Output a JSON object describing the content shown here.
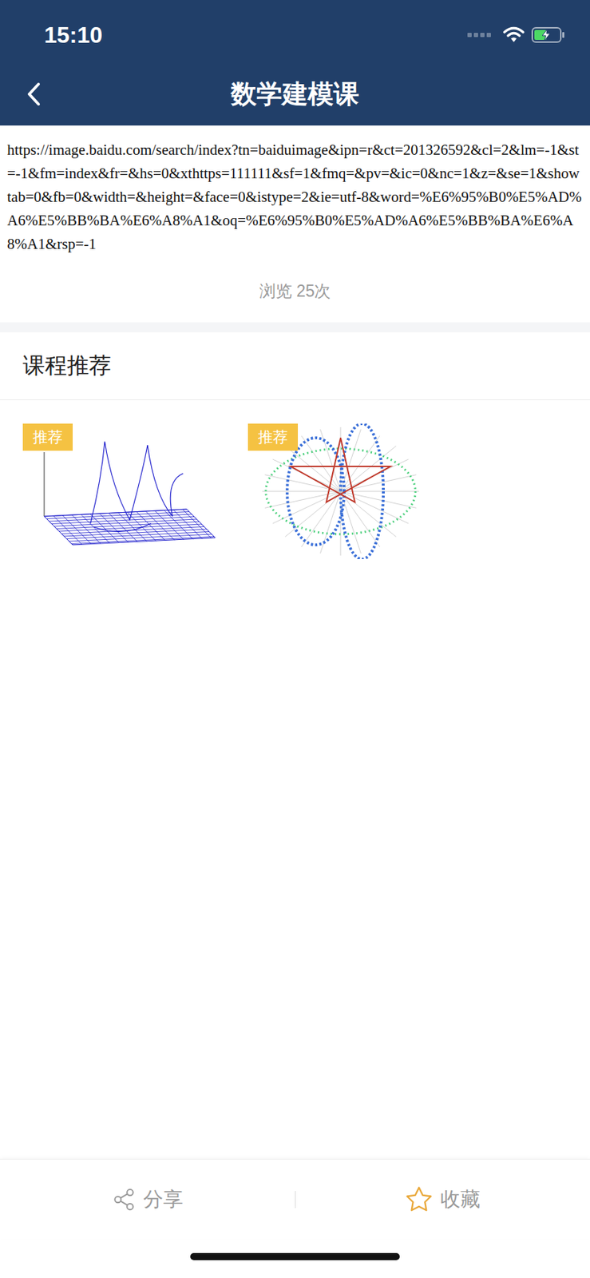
{
  "status_bar": {
    "time": "15:10",
    "battery": {
      "level": 0.5,
      "charging": true
    }
  },
  "nav": {
    "title": "数学建模课"
  },
  "article": {
    "url": "https://image.baidu.com/search/index?tn=baiduimage&ipn=r&ct=201326592&cl=2&lm=-1&st=-1&fm=index&fr=&hs=0&xthttps=111111&sf=1&fmq=&pv=&ic=0&nc=1&z=&se=1&showtab=0&fb=0&width=&height=&face=0&istype=2&ie=utf-8&word=%E6%95%B0%E5%AD%A6%E5%BB%BA%E6%A8%A1&oq=%E6%95%B0%E5%AD%A6%E5%BB%BA%E6%A8%A1&rsp=-1",
    "views": "浏览 25次"
  },
  "recommend": {
    "title": "课程推荐",
    "courses": [
      {
        "badge": "推荐",
        "kind": "surface"
      },
      {
        "badge": "推荐",
        "kind": "star"
      }
    ]
  },
  "toolbar": {
    "buttons": [
      {
        "label": "分享",
        "kind": "share"
      },
      {
        "label": "收藏",
        "kind": "favorite"
      }
    ]
  }
}
